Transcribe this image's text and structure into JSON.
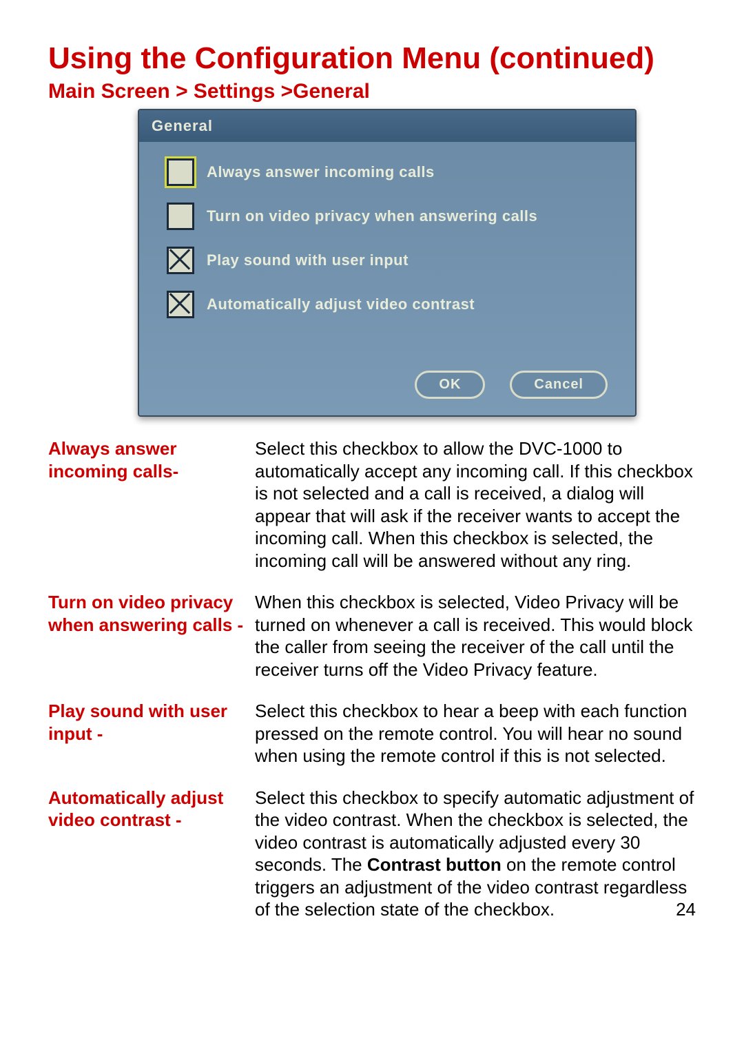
{
  "title": "Using the Configuration Menu (continued)",
  "breadcrumb": "Main Screen > Settings >General",
  "dialog": {
    "title": "General",
    "options": [
      {
        "label": "Always answer incoming calls",
        "checked": false,
        "focused": true
      },
      {
        "label": "Turn on video privacy when answering calls",
        "checked": false,
        "focused": false
      },
      {
        "label": "Play sound with user input",
        "checked": true,
        "focused": false
      },
      {
        "label": "Automatically adjust video contrast",
        "checked": true,
        "focused": false
      }
    ],
    "ok": "OK",
    "cancel": "Cancel"
  },
  "descriptions": [
    {
      "key": "Always answer incoming calls-",
      "val": "Select this checkbox to allow the DVC-1000 to automatically accept any incoming call. If this checkbox is not selected and a call is received, a dialog will appear that will ask if the receiver wants to accept the incoming call. When this checkbox is selected, the incoming call will be answered without any ring."
    },
    {
      "key": "Turn on video privacy when answering calls -",
      "val": "When this checkbox is selected, Video Privacy will be turned on whenever a call is received. This would block the caller from seeing the receiver of the call until the receiver turns off the Video Privacy feature."
    },
    {
      "key": "Play sound with user input -",
      "val": "Select this checkbox to hear a beep with each function pressed on the remote control. You will hear no sound when using the remote control if this is not selected."
    },
    {
      "key": "Automatically adjust video contrast -",
      "val_pre": "Select this checkbox to specify automatic adjustment of the video contrast. When the checkbox is selected, the video contrast is automatically adjusted every 30 seconds. The ",
      "val_bold": "Contrast button",
      "val_post": " on the remote control triggers an adjustment of the video contrast regardless of the selection state of the checkbox."
    }
  ],
  "page_number": "24"
}
